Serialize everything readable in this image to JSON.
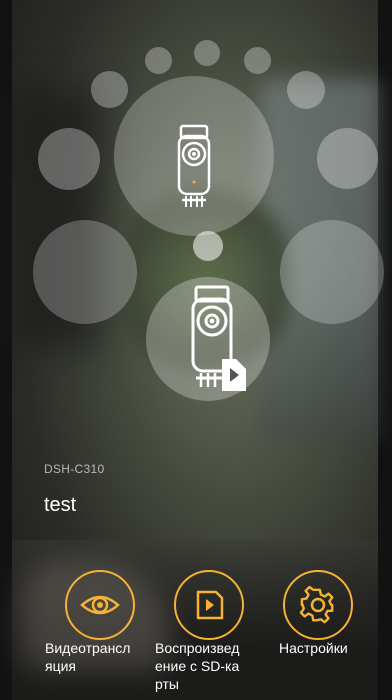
{
  "device": {
    "model": "DSH-C310",
    "name": "test"
  },
  "carousel": {
    "main_icon": "camera-icon",
    "secondary_icon": "camera-sd-playback-icon"
  },
  "actions": [
    {
      "label": "Видеотрансляция",
      "icon": "eye-icon"
    },
    {
      "label": "Воспроизведение с SD-карты",
      "icon": "sd-card-play-icon"
    },
    {
      "label": "Настройки",
      "icon": "gear-icon"
    }
  ],
  "colors": {
    "accent": "#f5b233"
  }
}
